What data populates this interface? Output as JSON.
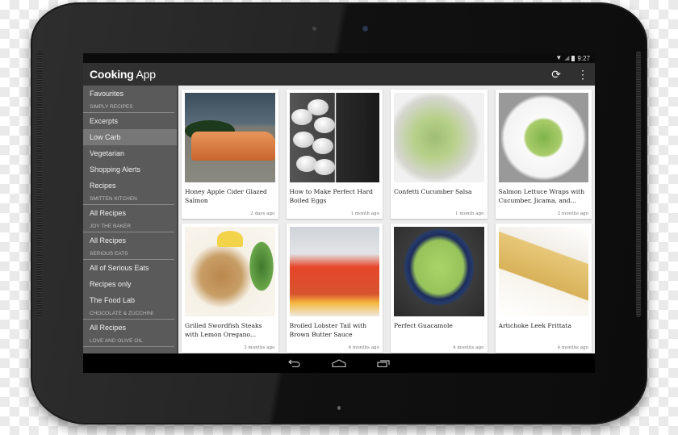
{
  "status_bar": {
    "time": "9:27",
    "wifi_icon": "wifi-icon",
    "signal_icon": "signal-icon",
    "battery_icon": "battery-icon"
  },
  "action_bar": {
    "title_bold": "Cooking",
    "title_rest": "App",
    "actions": [
      {
        "name": "refresh",
        "icon": "refresh-icon",
        "glyph": "⟳"
      },
      {
        "name": "overflow-menu",
        "icon": "more-vertical-icon",
        "glyph": "⋮"
      }
    ]
  },
  "drawer": {
    "items": [
      {
        "type": "item",
        "label": "Favourites"
      },
      {
        "type": "header",
        "label": "Simply Recipes"
      },
      {
        "type": "item",
        "label": "Excerpts"
      },
      {
        "type": "item",
        "label": "Low Carb",
        "active": true
      },
      {
        "type": "item",
        "label": "Vegetarian"
      },
      {
        "type": "item",
        "label": "Shopping Alerts"
      },
      {
        "type": "item",
        "label": "Recipes"
      },
      {
        "type": "header",
        "label": "Smitten Kitchen"
      },
      {
        "type": "item",
        "label": "All Recipes"
      },
      {
        "type": "header",
        "label": "Joy the Baker"
      },
      {
        "type": "item",
        "label": "All Recipes"
      },
      {
        "type": "header",
        "label": "Serious Eats"
      },
      {
        "type": "item",
        "label": "All of Serious Eats"
      },
      {
        "type": "item",
        "label": "Recipes only"
      },
      {
        "type": "item",
        "label": "The Food Lab"
      },
      {
        "type": "header",
        "label": "Chocolate & Zucchini"
      },
      {
        "type": "item",
        "label": "All Recipes"
      },
      {
        "type": "header",
        "label": "Love and Olive Oil"
      }
    ]
  },
  "recipes": [
    {
      "title": "Honey Apple Cider Glazed Salmon",
      "time": "2 days ago",
      "image": "salmon"
    },
    {
      "title": "How to Make Perfect Hard Boiled Eggs",
      "time": "1 month ago",
      "image": "eggs"
    },
    {
      "title": "Confetti Cucumber Salsa",
      "time": "1 month ago",
      "image": "salsa"
    },
    {
      "title": "Salmon Lettuce Wraps with Cucumber, Jicama, and...",
      "time": "2 months ago",
      "image": "wrap"
    },
    {
      "title": "Grilled Swordfish Steaks with Lemon Oregano...",
      "time": "3 months ago",
      "image": "sword"
    },
    {
      "title": "Broiled Lobster Tail with Brown Butter Sauce",
      "time": "4 months ago",
      "image": "lobster"
    },
    {
      "title": "Perfect Guacamole",
      "time": "4 months ago",
      "image": "guac"
    },
    {
      "title": "Artichoke Leek Frittata",
      "time": "4 months ago",
      "image": "frittata"
    }
  ],
  "nav_bar": {
    "back": {
      "icon": "back-icon",
      "glyph": "↩"
    },
    "home": {
      "icon": "home-icon"
    },
    "recents": {
      "icon": "recents-icon"
    }
  }
}
